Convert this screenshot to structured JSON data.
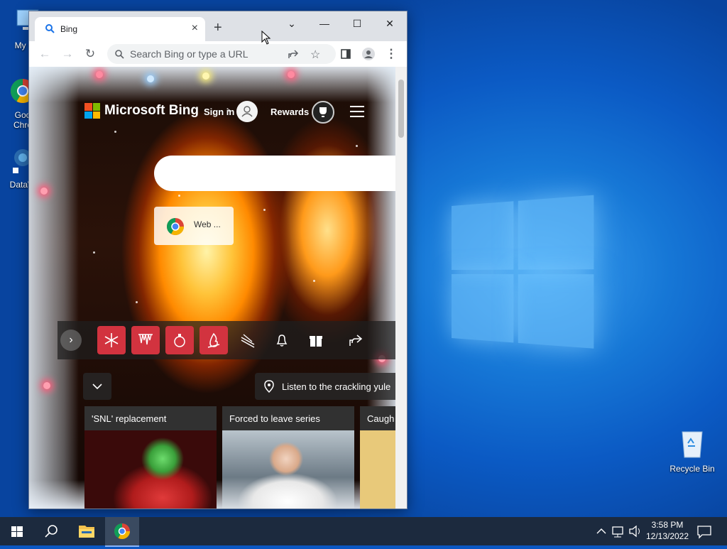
{
  "desktop": {
    "icons": [
      {
        "label": "My Co",
        "icon": "computer-icon"
      },
      {
        "label": "Goo Chro",
        "icon": "chrome-icon"
      },
      {
        "label": "DataW",
        "icon": "database-icon"
      },
      {
        "label": "Recycle Bin",
        "icon": "recycle-bin-icon"
      }
    ]
  },
  "browser": {
    "tab_title": "Bing",
    "new_tab": "+",
    "omnibox_placeholder": "Search Bing or type a URL",
    "window_controls": [
      "⌄",
      "—",
      "☐",
      "✕"
    ]
  },
  "bing": {
    "logo_text": "Microsoft Bing",
    "sign_in": "Sign in",
    "rewards": "Rewards",
    "web_tile_label": "Web ...",
    "location_text": "Listen to the crackling yule",
    "theme_buttons": [
      "snowflake-icon",
      "icicles-icon",
      "ornament-icon",
      "fire-icon",
      "ski-icon",
      "bell-icon",
      "gift-icon",
      "share-icon"
    ],
    "cards": [
      {
        "headline": "'SNL' replacement"
      },
      {
        "headline": "Forced to leave series"
      },
      {
        "headline": "Caugh"
      }
    ]
  },
  "taskbar": {
    "time": "3:58 PM",
    "date": "12/13/2022"
  },
  "colors": {
    "accent_red": "#d2333f",
    "taskbar": "#1c2a3e",
    "desktop_blue": "#0b5ac4"
  }
}
